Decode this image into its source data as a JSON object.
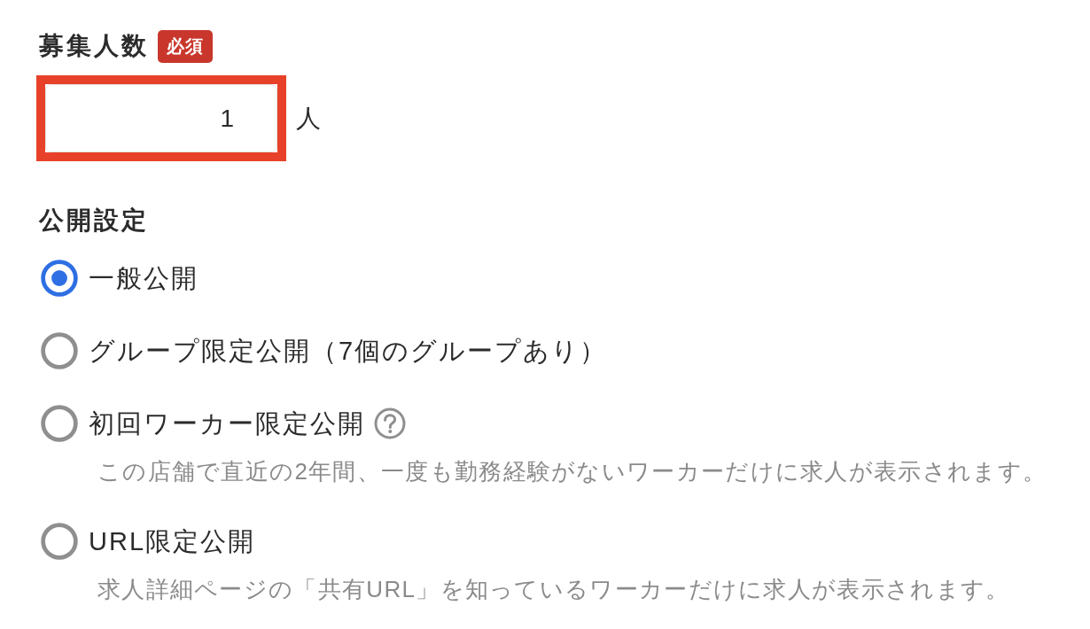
{
  "recruit_count": {
    "label": "募集人数",
    "badge": "必須",
    "field": {
      "value": "1",
      "highlighted": true
    },
    "unit": "人"
  },
  "visibility": {
    "label": "公開設定",
    "options": [
      {
        "label": "一般公開",
        "selected": true,
        "help": false
      },
      {
        "label": "グループ限定公開（7個のグループあり）",
        "selected": false,
        "help": false
      },
      {
        "label": "初回ワーカー限定公開",
        "selected": false,
        "help": true,
        "description": "この店舗で直近の2年間、一度も勤務経験がないワーカーだけに求人が表示されます。"
      },
      {
        "label": "URL限定公開",
        "selected": false,
        "help": false,
        "description": "求人詳細ページの「共有URL」を知っているワーカーだけに求人が表示されます。"
      }
    ]
  }
}
